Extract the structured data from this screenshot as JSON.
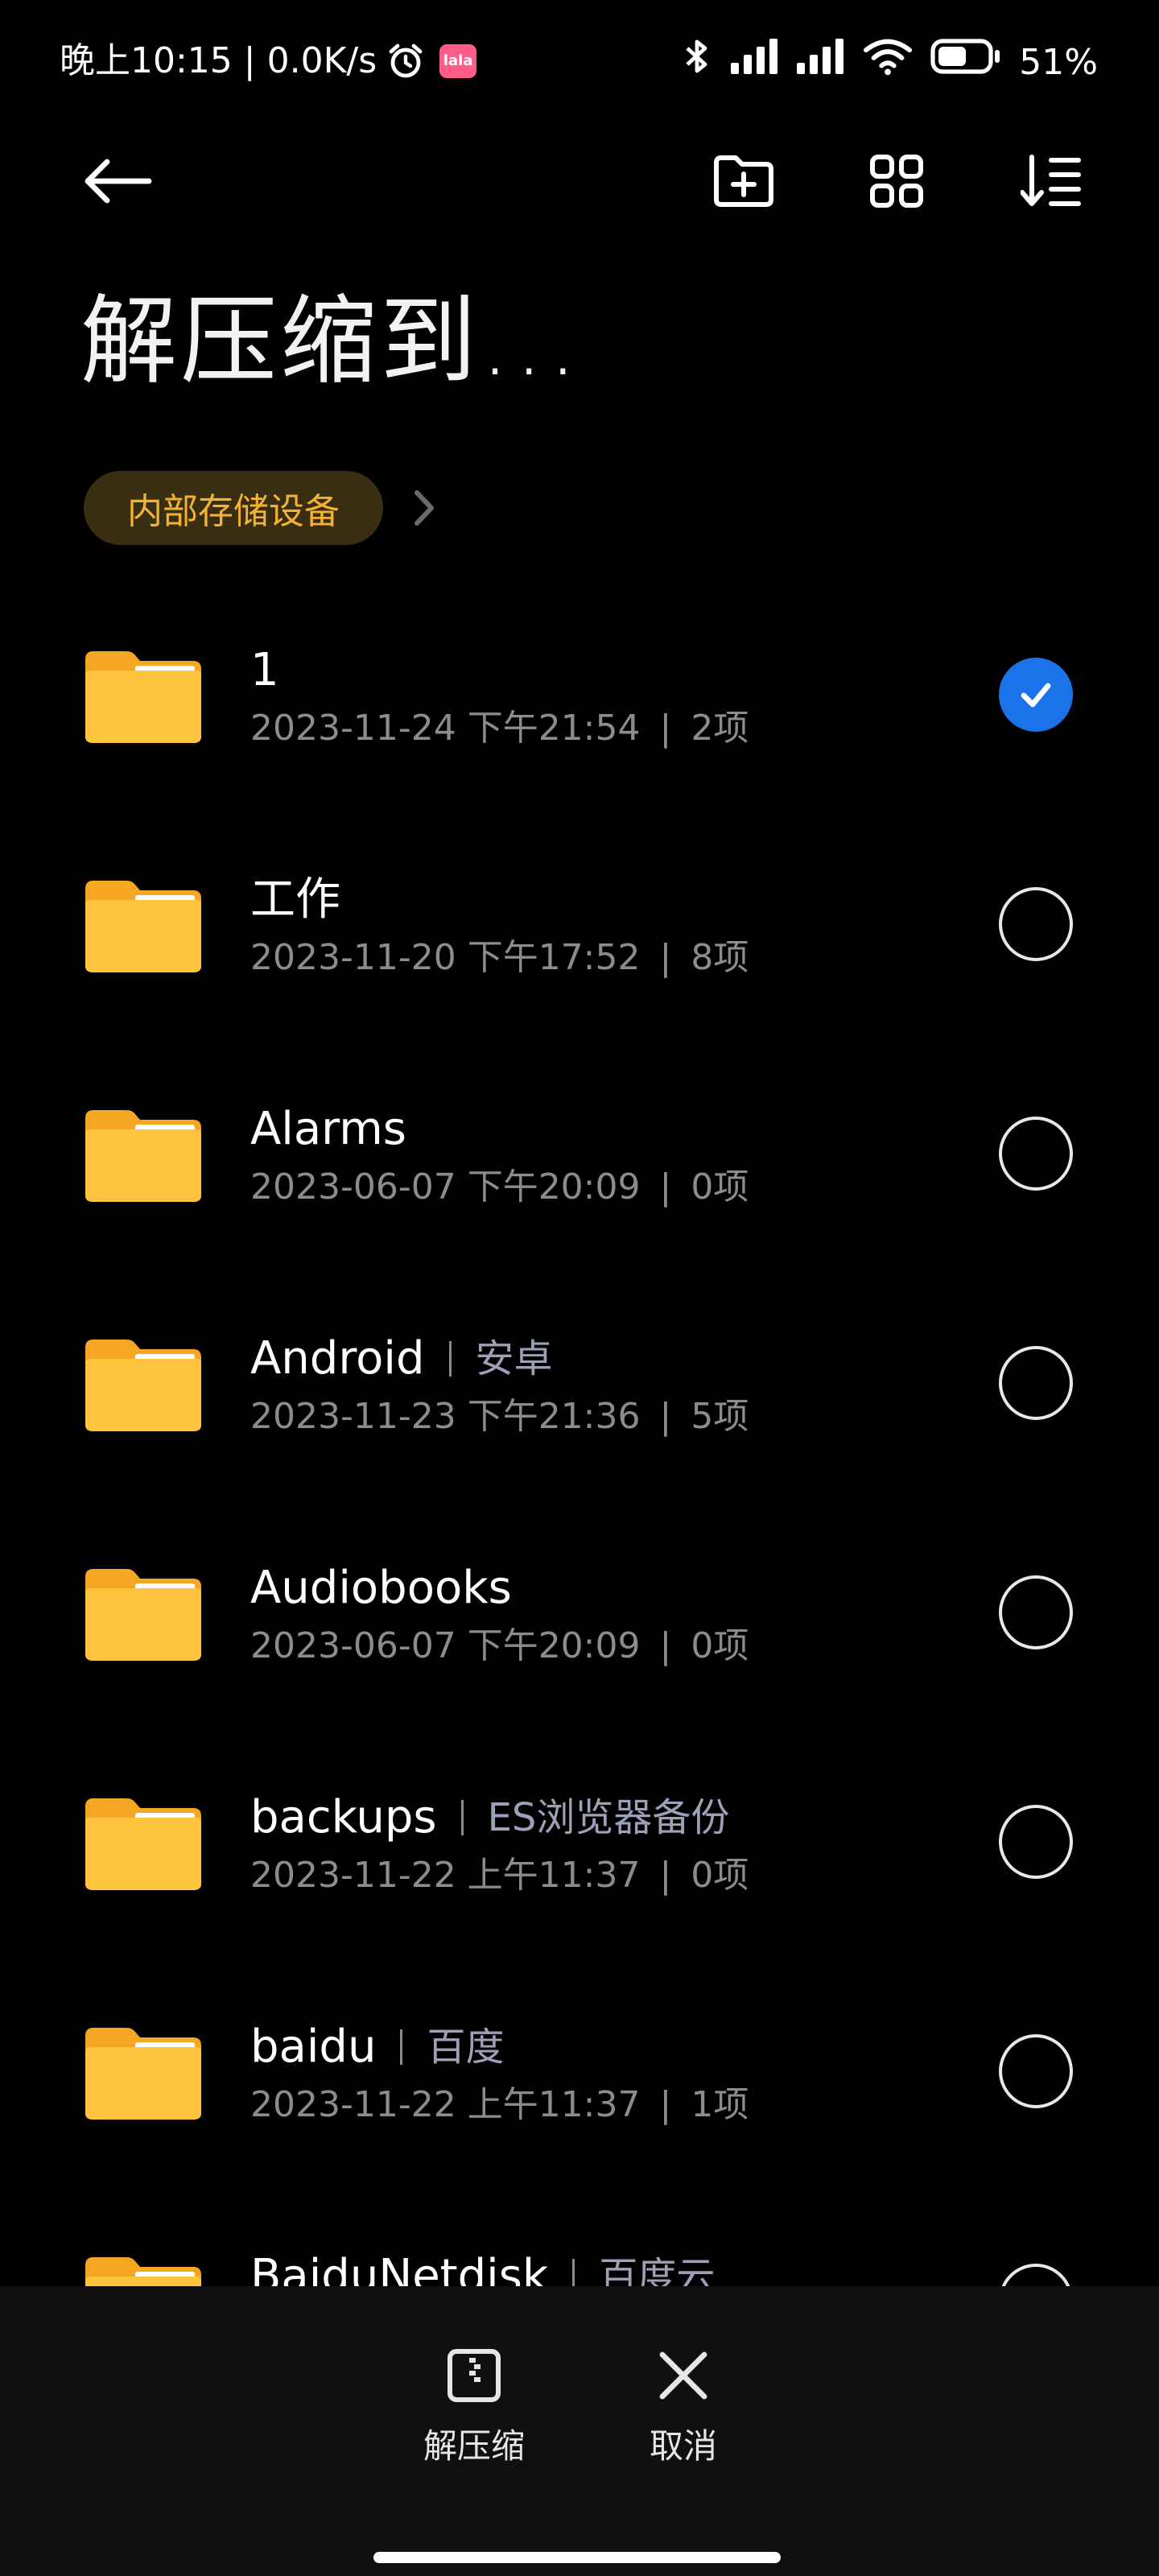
{
  "status_bar": {
    "time_text": "晚上10:15 | 0.0K/s",
    "app_badge": "lala",
    "battery": "51%"
  },
  "title": "解压缩到...",
  "breadcrumb": {
    "current": "内部存储设备"
  },
  "files": [
    {
      "name": "1",
      "alias": "",
      "date": "2023-11-24 下午21:54",
      "count": "2项",
      "selected": true
    },
    {
      "name": "工作",
      "alias": "",
      "date": "2023-11-20 下午17:52",
      "count": "8项",
      "selected": false
    },
    {
      "name": "Alarms",
      "alias": "",
      "date": "2023-06-07 下午20:09",
      "count": "0项",
      "selected": false
    },
    {
      "name": "Android",
      "alias": "安卓",
      "date": "2023-11-23 下午21:36",
      "count": "5项",
      "selected": false
    },
    {
      "name": "Audiobooks",
      "alias": "",
      "date": "2023-06-07 下午20:09",
      "count": "0项",
      "selected": false
    },
    {
      "name": "backups",
      "alias": "ES浏览器备份",
      "date": "2023-11-22 上午11:37",
      "count": "0项",
      "selected": false
    },
    {
      "name": "baidu",
      "alias": "百度",
      "date": "2023-11-22 上午11:37",
      "count": "1项",
      "selected": false
    },
    {
      "name": "BaiduNetdisk",
      "alias": "百度云",
      "date": "",
      "count": "",
      "selected": false
    }
  ],
  "meta_separator": "|",
  "actions": {
    "extract_label": "解压缩",
    "cancel_label": "取消"
  },
  "colors": {
    "folder": "#FFC43D",
    "accent": "#1A73E8",
    "chip_text": "#F2B233"
  }
}
